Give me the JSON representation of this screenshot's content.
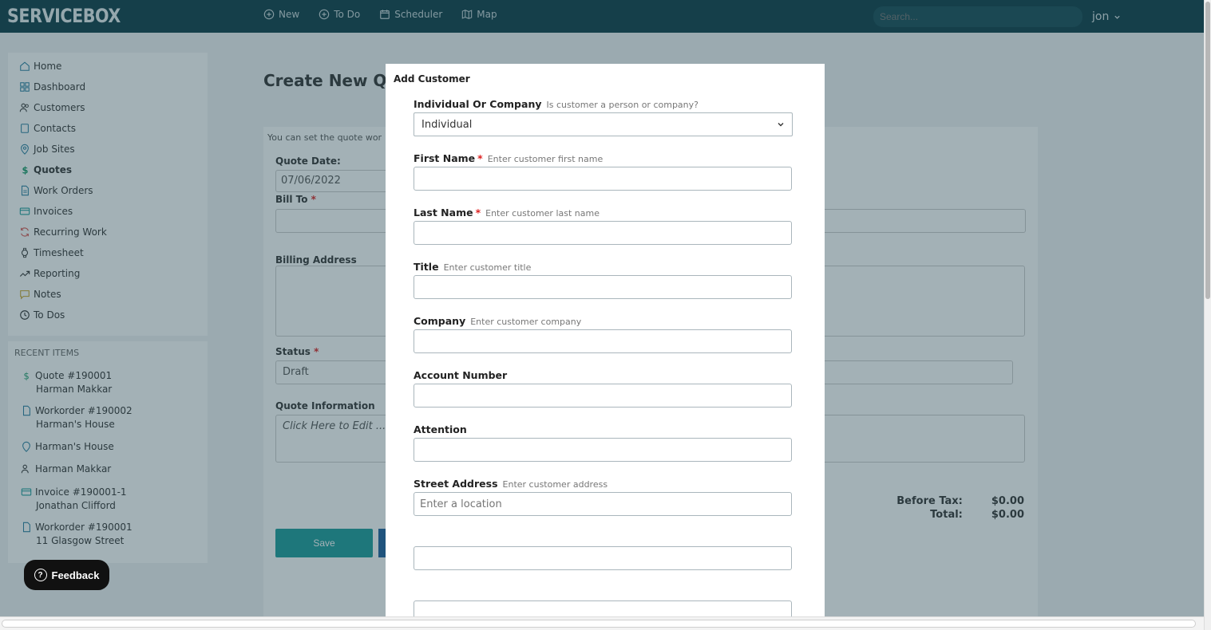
{
  "app": {
    "logo": "SERVICEBOX"
  },
  "topnav": {
    "items": [
      {
        "label": "New",
        "icon": "plus-circle-icon"
      },
      {
        "label": "To Do",
        "icon": "plus-circle-icon"
      },
      {
        "label": "Scheduler",
        "icon": "calendar-icon"
      },
      {
        "label": "Map",
        "icon": "map-icon"
      }
    ],
    "search_placeholder": "Search...",
    "user": "jon"
  },
  "sidebar": {
    "items": [
      {
        "label": "Home",
        "icon": "home-icon"
      },
      {
        "label": "Dashboard",
        "icon": "dashboard-icon"
      },
      {
        "label": "Customers",
        "icon": "users-icon"
      },
      {
        "label": "Contacts",
        "icon": "contact-icon"
      },
      {
        "label": "Job Sites",
        "icon": "location-pin-icon"
      },
      {
        "label": "Quotes",
        "icon": "dollar-icon"
      },
      {
        "label": "Work Orders",
        "icon": "document-icon"
      },
      {
        "label": "Invoices",
        "icon": "card-icon"
      },
      {
        "label": "Recurring Work",
        "icon": "refresh-icon"
      },
      {
        "label": "Timesheet",
        "icon": "watch-icon"
      },
      {
        "label": "Reporting",
        "icon": "trend-icon"
      },
      {
        "label": "Notes",
        "icon": "note-icon"
      },
      {
        "label": "To Dos",
        "icon": "clock-icon"
      }
    ]
  },
  "recent": {
    "title": "RECENT ITEMS",
    "items": [
      {
        "label": "Quote #190001",
        "sub": "Harman Makkar",
        "icon": "dollar-icon"
      },
      {
        "label": "Workorder #190002",
        "sub": "Harman's House",
        "icon": "document-icon"
      },
      {
        "label": "Harman's House",
        "sub": "",
        "icon": "location-pin-icon"
      },
      {
        "label": "Harman Makkar",
        "sub": "",
        "icon": "users-icon"
      },
      {
        "label": "Invoice #190001-1",
        "sub": "Jonathan Clifford",
        "icon": "card-icon"
      },
      {
        "label": "Workorder #190001",
        "sub": "11 Glasgow Street",
        "icon": "document-icon"
      }
    ]
  },
  "page": {
    "title": "Create New Qu",
    "intro": "You can set the quote wor",
    "quote_date_label": "Quote Date:",
    "quote_date_value": "07/06/2022",
    "bill_to_label": "Bill To",
    "billing_address_label": "Billing Address",
    "status_label": "Status",
    "status_value": "Draft",
    "quote_info_label": "Quote Information",
    "quote_info_placeholder": "Click Here to Edit ...",
    "save_label": "Save",
    "before_tax_label": "Before Tax:",
    "before_tax_value": "$0.00",
    "total_label": "Total:",
    "total_value": "$0.00"
  },
  "feedback": {
    "label": "Feedback"
  },
  "modal": {
    "title": "Add Customer",
    "type": {
      "label": "Individual Or Company",
      "hint": "Is customer a person or company?",
      "value": "Individual"
    },
    "first_name": {
      "label": "First Name",
      "hint": "Enter customer first name"
    },
    "last_name": {
      "label": "Last Name",
      "hint": "Enter customer last name"
    },
    "title_field": {
      "label": "Title",
      "hint": "Enter customer title"
    },
    "company": {
      "label": "Company",
      "hint": "Enter customer company"
    },
    "account_number": {
      "label": "Account Number"
    },
    "attention": {
      "label": "Attention"
    },
    "street_address": {
      "label": "Street Address",
      "hint": "Enter customer address",
      "placeholder": "Enter a location"
    }
  }
}
